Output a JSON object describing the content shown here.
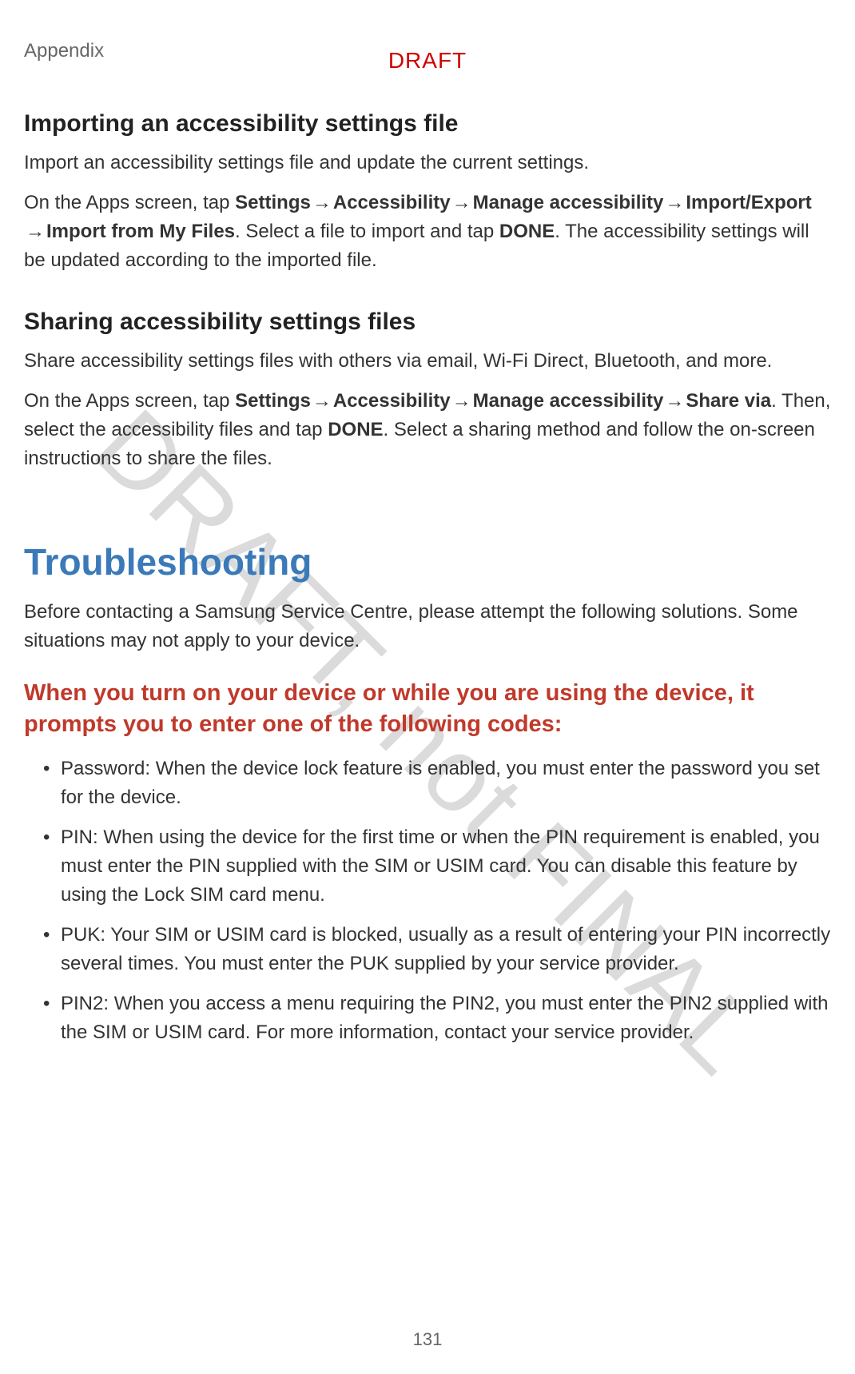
{
  "header": {
    "section": "Appendix",
    "draft_top": "DRAFT"
  },
  "watermark": "DRAFT, not FINAL",
  "page_number": "131",
  "importing": {
    "heading": "Importing an accessibility settings file",
    "p1": "Import an accessibility settings file and update the current settings.",
    "p2a": "On the Apps screen, tap ",
    "p2_b_settings": "Settings",
    "arrow": " → ",
    "p2_b_accessibility": "Accessibility",
    "p2_b_manage": "Manage accessibility",
    "p2_b_importexport": "Import/Export",
    "p2_b_importfrom": "Import from My Files",
    "p2_mid": ". Select a file to import and tap ",
    "p2_b_done": "DONE",
    "p2_end": ". The accessibility settings will be updated according to the imported file."
  },
  "sharing": {
    "heading": "Sharing accessibility settings files",
    "p1": "Share accessibility settings files with others via email, Wi-Fi Direct, Bluetooth, and more.",
    "p2a": "On the Apps screen, tap ",
    "p2_b_settings": "Settings",
    "p2_b_accessibility": "Accessibility",
    "p2_b_manage": "Manage accessibility",
    "p2_b_sharevia": "Share via",
    "p2_mid": ". Then, select the accessibility files and tap ",
    "p2_b_done": "DONE",
    "p2_end": ". Select a sharing method and follow the on-screen instructions to share the files."
  },
  "troubleshooting": {
    "heading": "Troubleshooting",
    "intro": "Before contacting a Samsung Service Centre, please attempt the following solutions. Some situations may not apply to your device.",
    "codes_heading": "When you turn on your device or while you are using the device, it prompts you to enter one of the following codes:",
    "bullets": [
      "Password: When the device lock feature is enabled, you must enter the password you set for the device.",
      "PIN: When using the device for the first time or when the PIN requirement is enabled, you must enter the PIN supplied with the SIM or USIM card. You can disable this feature by using the Lock SIM card menu.",
      "PUK: Your SIM or USIM card is blocked, usually as a result of entering your PIN incorrectly several times. You must enter the PUK supplied by your service provider.",
      "PIN2: When you access a menu requiring the PIN2, you must enter the PIN2 supplied with the SIM or USIM card. For more information, contact your service provider."
    ]
  }
}
